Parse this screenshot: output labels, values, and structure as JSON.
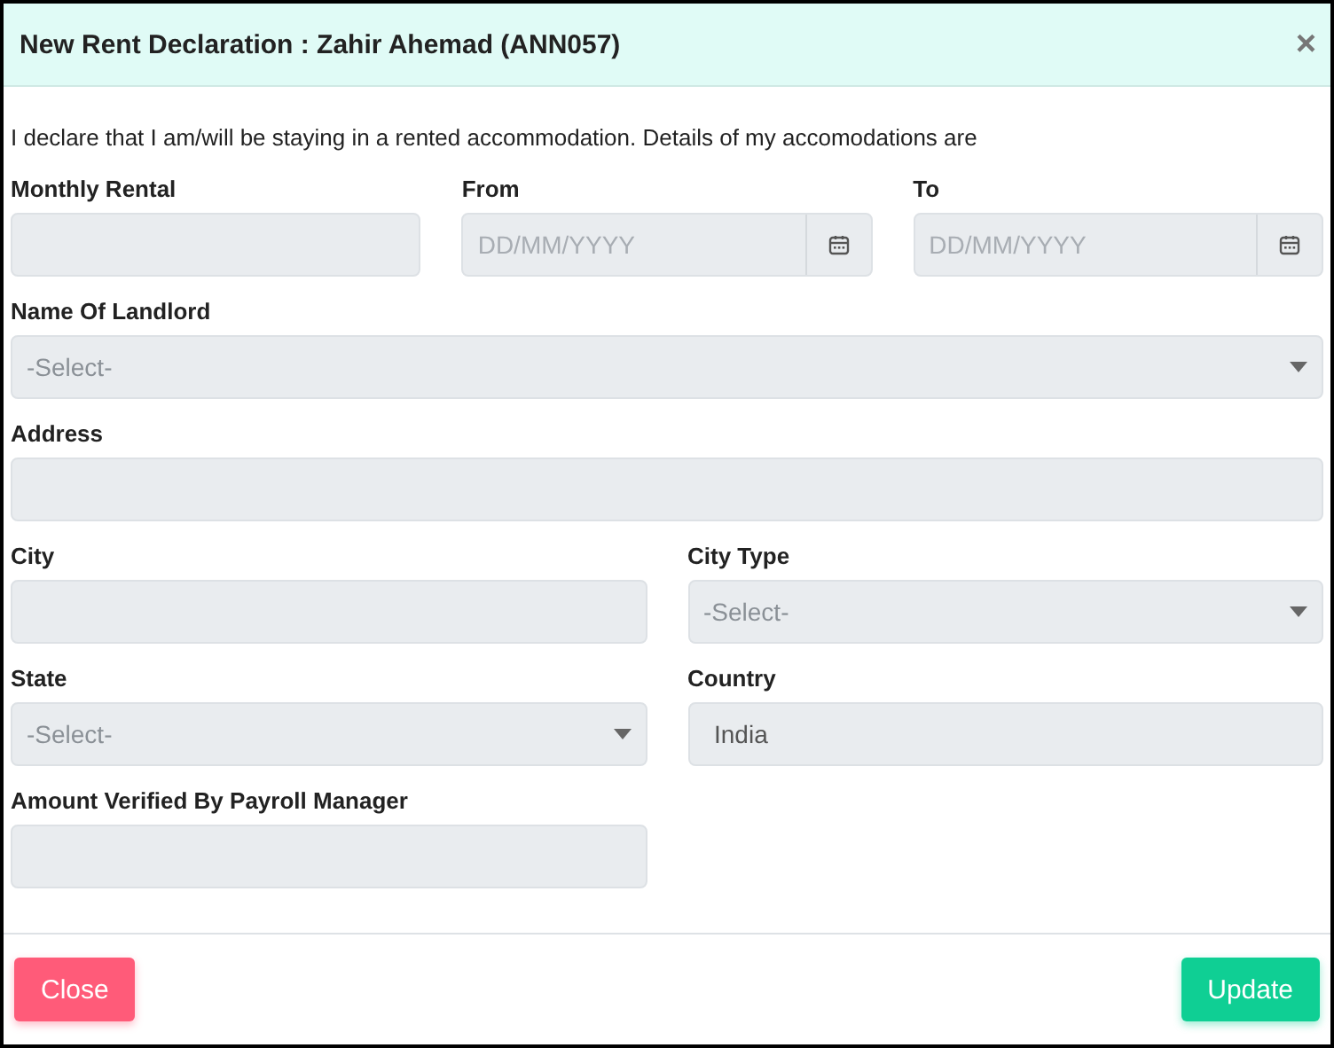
{
  "dialog": {
    "title": "New Rent Declaration : Zahir Ahemad (ANN057)",
    "close_icon": "×"
  },
  "intro": "I declare that I am/will be staying in a rented accommodation. Details of my accomodations are",
  "top_row": [
    {
      "label": "Monthly Rental",
      "kind": "text"
    },
    {
      "label": "From",
      "kind": "date",
      "placeholder": "DD/MM/YYYY"
    },
    {
      "label": "To",
      "kind": "date",
      "placeholder": "DD/MM/YYYY"
    }
  ],
  "full_rows": [
    {
      "label": "Name Of Landlord",
      "kind": "select",
      "placeholder": "-Select-"
    },
    {
      "label": "Address",
      "kind": "text"
    }
  ],
  "pair_grid": [
    {
      "label": "City",
      "kind": "text"
    },
    {
      "label": "City Type",
      "kind": "select",
      "placeholder": "-Select-"
    },
    {
      "label": "State",
      "kind": "select",
      "placeholder": "-Select-"
    },
    {
      "label": "Country",
      "kind": "readonly",
      "value": "India"
    },
    {
      "label": "Amount Verified By Payroll Manager",
      "kind": "text"
    }
  ],
  "buttons": [
    {
      "label": "Close",
      "kind": "danger"
    },
    {
      "label": "Update",
      "kind": "primary"
    }
  ]
}
